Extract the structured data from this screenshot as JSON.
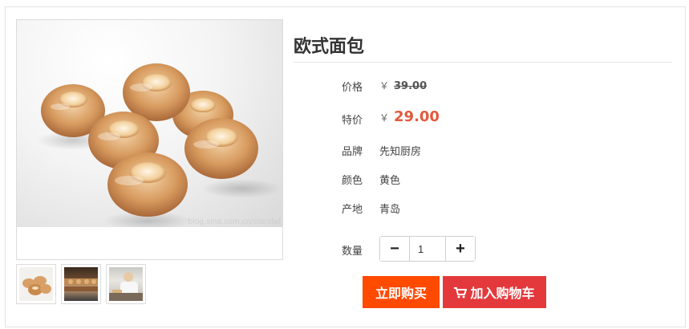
{
  "product": {
    "title": "欧式面包",
    "watermark": "blog.sina.com.cn/starsfat"
  },
  "details": {
    "price_label": "价格",
    "currency": "￥",
    "price": "39.00",
    "sale_label": "特价",
    "sale_price": "29.00",
    "brand_label": "品牌",
    "brand": "先知厨房",
    "color_label": "颜色",
    "color": "黄色",
    "origin_label": "产地",
    "origin": "青岛"
  },
  "quantity": {
    "label": "数量",
    "value": "1",
    "minus": "−",
    "plus": "+"
  },
  "actions": {
    "buy_now": "立即购买",
    "add_to_cart": "加入购物车"
  },
  "thumbnails": [
    "bundt-cakes-thumb",
    "bakery-display-thumb",
    "baker-thumb"
  ],
  "colors": {
    "sale": "#e4593c",
    "buy_button": "#ff4a00",
    "cart_button": "#e4393c"
  }
}
